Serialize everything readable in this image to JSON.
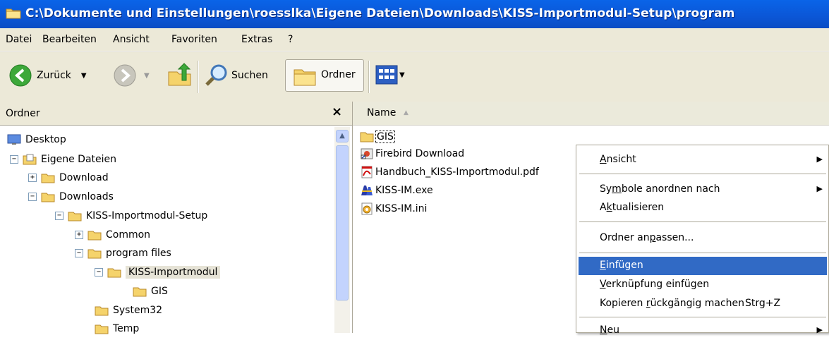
{
  "window": {
    "title": "C:\\Dokumente und Einstellungen\\roesslka\\Eigene Dateien\\Downloads\\KISS-Importmodul-Setup\\program"
  },
  "menu": [
    {
      "id": "datei",
      "label": "Datei"
    },
    {
      "id": "bearbeiten",
      "label": "Bearbeiten"
    },
    {
      "id": "ansicht",
      "label": "Ansicht"
    },
    {
      "id": "favoriten",
      "label": "Favoriten"
    },
    {
      "id": "extras",
      "label": "Extras"
    },
    {
      "id": "help",
      "label": "?"
    }
  ],
  "toolbar": {
    "back_label": "Zurück",
    "search_label": "Suchen",
    "folders_label": "Ordner"
  },
  "folders_pane": {
    "title": "Ordner",
    "close_glyph": "×"
  },
  "tree": [
    {
      "label": "Desktop"
    },
    {
      "label": "Eigene Dateien",
      "exp": "−"
    },
    {
      "label": "Download",
      "exp": "+"
    },
    {
      "label": "Downloads",
      "exp": "−"
    },
    {
      "label": "KISS-Importmodul-Setup",
      "exp": "−"
    },
    {
      "label": "Common",
      "exp": "+"
    },
    {
      "label": "program files",
      "exp": "−"
    },
    {
      "label": "KISS-Importmodul",
      "exp": "−",
      "selected": true
    },
    {
      "label": "GIS"
    },
    {
      "label": "System32"
    },
    {
      "label": "Temp"
    }
  ],
  "list": {
    "column_name": "Name",
    "sort_glyph": "▲",
    "files": [
      {
        "name": "GIS",
        "icon": "folder-icon"
      },
      {
        "name": "Firebird Download",
        "icon": "shortcut-icon"
      },
      {
        "name": "Handbuch_KISS-Importmodul.pdf",
        "icon": "pdf-icon"
      },
      {
        "name": "KISS-IM.exe",
        "icon": "exe-icon"
      },
      {
        "name": "KISS-IM.ini",
        "icon": "ini-icon"
      }
    ]
  },
  "context_menu": {
    "items": [
      {
        "label": "Ansicht",
        "submenu": true
      },
      {
        "label": "Symbole anordnen nach",
        "submenu": true
      },
      {
        "label": "Aktualisieren"
      },
      {
        "label": "Ordner anpassen..."
      },
      {
        "label": "Einfügen",
        "highlighted": true
      },
      {
        "label": "Verknüpfung einfügen"
      },
      {
        "label": "Kopieren rückgängig machen",
        "shortcut": "Strg+Z"
      },
      {
        "label": "Neu",
        "submenu": true
      }
    ],
    "submenu_glyph": "▶"
  },
  "colors": {
    "title_blue": "#0b56d6",
    "menu_highlight": "#316ac5",
    "folder_yellow": "#f5d36b"
  }
}
